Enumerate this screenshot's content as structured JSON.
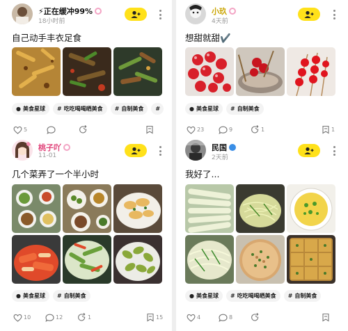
{
  "posts": [
    {
      "user": "正在缓冲99%",
      "time": "18小时前",
      "title": "自己动手丰衣足食",
      "tags": [
        "美食星球",
        "吃吃喝喝晒美食",
        "自制美食"
      ],
      "counts": {
        "likes": "5",
        "comments": "",
        "shares": "",
        "favorites": ""
      }
    },
    {
      "user": "小玖",
      "time": "4天前",
      "title": "想甜就甜✔️",
      "tags": [
        "美食星球",
        "自制美食"
      ],
      "counts": {
        "likes": "23",
        "comments": "9",
        "shares": "1",
        "favorites": "1"
      }
    },
    {
      "user": "桃子吖",
      "time": "11-01",
      "title": "几个菜弄了一个半小时",
      "tags": [
        "美食星球",
        "自制美食"
      ],
      "counts": {
        "likes": "10",
        "comments": "12",
        "shares": "1",
        "favorites": "15"
      }
    },
    {
      "user": "民国",
      "time": "2天前",
      "title": "我好了...",
      "tags": [
        "美食星球",
        "吃吃喝喝晒美食",
        "自制美食"
      ],
      "counts": {
        "likes": "4",
        "comments": "8",
        "shares": "",
        "favorites": ""
      }
    }
  ],
  "colors": {
    "follow": "#ffe11a",
    "background": "#eeeeee"
  },
  "icons": {
    "follow": "add-user-icon",
    "like": "heart-icon",
    "comment": "comment-icon",
    "share": "share-icon",
    "favorite": "bookmark-icon"
  }
}
